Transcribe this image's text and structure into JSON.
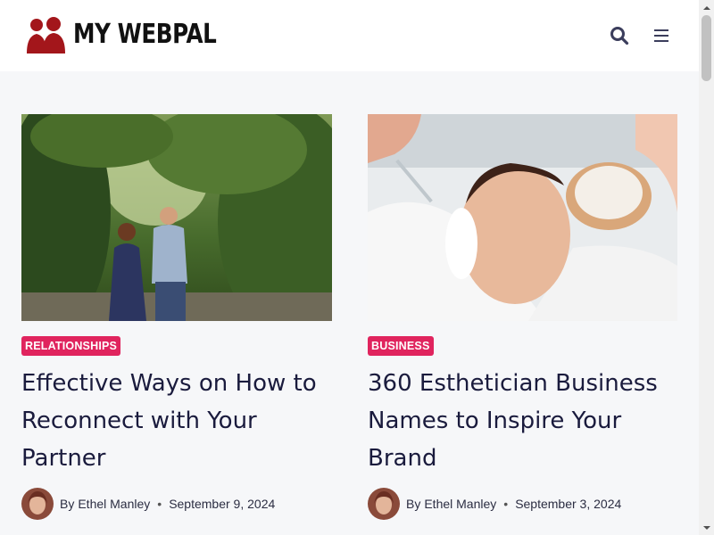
{
  "header": {
    "logo_text": "MY WEBPAL",
    "logo_icon": "two-people-silhouette-icon",
    "search_icon": "search-icon",
    "menu_icon": "hamburger-menu-icon"
  },
  "colors": {
    "accent": "#e0245e",
    "logo_red": "#a3161b",
    "title": "#1a1b3d",
    "background": "#f6f7f9"
  },
  "posts": [
    {
      "category": "RELATIONSHIPS",
      "title": "Effective Ways on How to Reconnect with Your Partner",
      "by": "By",
      "author": "Ethel Manley",
      "date": "September 9, 2024"
    },
    {
      "category": "BUSINESS",
      "title": "360 Esthetician Business Names to Inspire Your Brand",
      "by": "By",
      "author": "Ethel Manley",
      "date": "September 3, 2024"
    }
  ]
}
